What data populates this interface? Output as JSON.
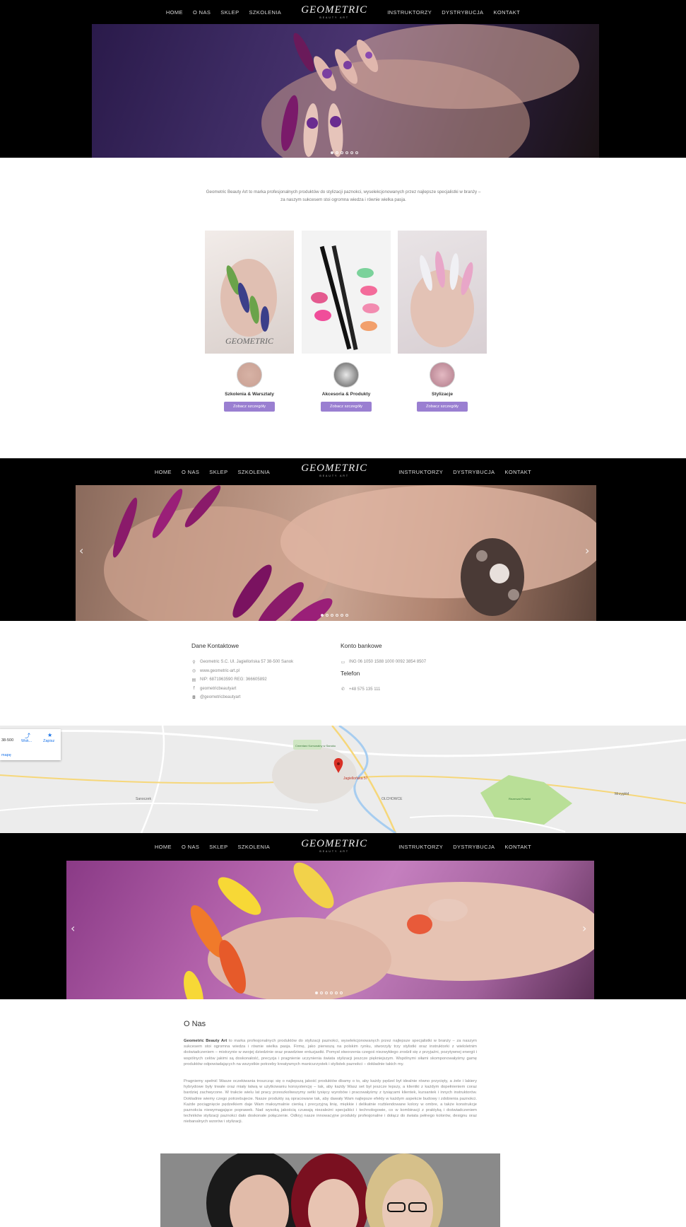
{
  "nav": {
    "left": [
      "HOME",
      "O NAS",
      "SKLEP",
      "SZKOLENIA"
    ],
    "right": [
      "INSTRUKTORZY",
      "DYSTRYBUCJA",
      "KONTAKT"
    ],
    "logo_word": "GEOMETRIC",
    "logo_sub": "BEAUTY ART"
  },
  "intro_text": "Geometric Beauty Art to marka profesjonalnych produktów do stylizacji paznokci, wyselekcjonowanych przez najlepsze specjalistki w branży – za naszym sukcesem stoi ogromna wiedza i równie wielka pasja.",
  "cards": [
    {
      "title": "Szkolenia & Warsztaty",
      "button": "Zobacz szczegóły"
    },
    {
      "title": "Akcesoria & Produkty",
      "button": "Zobacz szczegóły"
    },
    {
      "title": "Stylizacje",
      "button": "Zobacz szczegóły"
    }
  ],
  "contact": {
    "heading": "Dane Kontaktowe",
    "address": "Geometric S.C. Ul. Jagiellońska 57 38-500 Sanok",
    "www": "www.geometric-art.pl",
    "nip": "NIP: 6871963590 REG: 366605892",
    "facebook": "geometricbeautyart",
    "instagram": "@geometricbeautyart",
    "bank_heading": "Konto bankowe",
    "bank": "ING 06 1050 1588 1000 0092 3854 8507",
    "phone_heading": "Telefon",
    "phone": "+48 575 135 111"
  },
  "map": {
    "card_code": "38-500",
    "card_route": "Wsk...",
    "card_save": "Zapisz",
    "card_link": "mapę",
    "pin_label": "Jagiellońska 57",
    "labels": [
      "Sanoczek",
      "OLCHOWCE",
      "Mrzygłód",
      "Cmentarz Komunalny w Sanoku",
      "Rezerwat Polanki"
    ]
  },
  "onas": {
    "title": "O Nas",
    "p1_bold": "Geometric Beauty Art",
    "p1": " to marka profesjonalnych produktów do stylizacji paznokci, wyselekcjonowanych przez najlepsze specjalistki w branży – za naszym sukcesem stoi ogromna wiedza i równie wielka pasja. Firmę, jako pierwszą na polskim rynku, stworzyły trzy stylistki oraz instruktorki z wieloletnim doświadczeniem – mistrzynie w swojej dziedzinie oraz prawdziwe entuzjastki. Pomysł stworzenia czegoś niezwykłego zrodził się z przyjaźni, pozytywnej energii i wspólnych celów jakimi są doskonałość, precyzja i pragnienie uczynienia świata stylizacji jeszcze piękniejszym. Wspólnymi siłami skomponowałyśmy gamę produktów odpowiadających na wszystkie potrzeby kreatywnych manicurzystek i stylistek paznokci – dokładnie takich my.",
    "p2": "Pragniemy spełnić Wasze oczekiwania troszcząc się o najlepszą jakość produktów dbamy o to, aby każdy pędzel był idealnie równo przycięty, a żele i lakiery hybrydowe były trwałe oraz miały łatwą w użytkowaniu konsystencję – tak, aby każdy Wasz set był jeszcze lepszy, a klientki z każdym dopełnieniem coraz bardziej zachwycone. W trakcie wielu lat pracy przeszkoliwszymy setki tysięcy wyrobów i pracowałyśmy z tysiącami klientek, kursantek i innych instruktorów. Dokładnie wiemy czego potrzebujecie. Nasze produkty są opracowane tak, aby dawały Wam najlepsze efekty w każdym aspekcie budowy i zdobienia paznokci. Każde pociągnięcie pędzelkiem daje Wam maksymalnie cienką i precyzyjną linię, miękkie i delikatnie rozblendowane kolory w ombre, a także konstrukcje paznokcia niewymagające poprawek. Nad wysoką jakością czuwają niezależni specjaliści i technologowie, co w kombinacji z praktyką i doświadczeniem techników stylizacji paznokci dało doskonałe połączenie. Odkryj nasze innowacyjne produkty profesjonalne i dołącz do świata pełnego kolorów, designu oraz niebanalnych wzorów i stylizacji."
  },
  "colors": {
    "accent": "#9a7fd1",
    "nav_bg": "#000000",
    "map_bg": "#ececec"
  }
}
